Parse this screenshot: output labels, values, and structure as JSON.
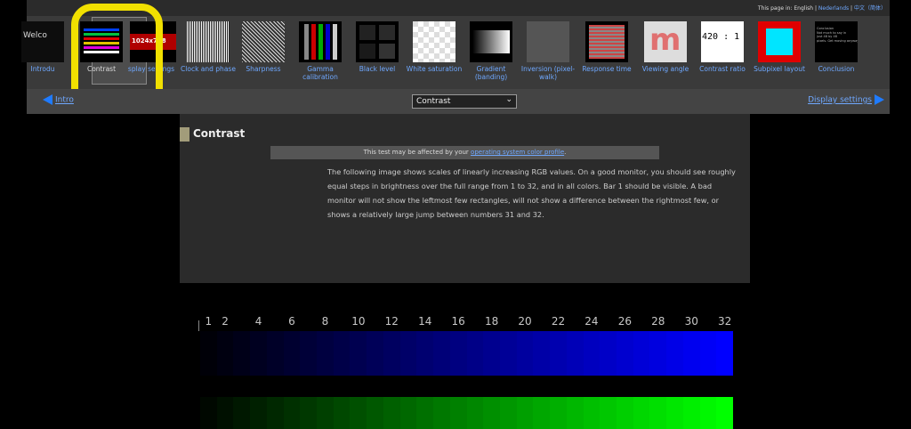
{
  "header": {
    "language_line": {
      "prefix": "This page in:",
      "current": "English",
      "sep1": " | ",
      "link1": "Nederlands",
      "sep2": " | ",
      "link2": "中文（简体）"
    }
  },
  "nav": {
    "items": [
      {
        "label": "Introduction",
        "thumb_text": "Welco"
      },
      {
        "label": "Contrast",
        "selected": true
      },
      {
        "label": "Display settings",
        "thumb_text": "1024x768"
      },
      {
        "label": "Clock and phase"
      },
      {
        "label": "Sharpness"
      },
      {
        "label": "Gamma calibration"
      },
      {
        "label": "Black level"
      },
      {
        "label": "White saturation"
      },
      {
        "label": "Gradient (banding)"
      },
      {
        "label": "Inversion (pixel-walk)"
      },
      {
        "label": "Response time"
      },
      {
        "label": "Viewing angle",
        "thumb_text": "m"
      },
      {
        "label": "Contrast ratio",
        "thumb_text": "420 : 1"
      },
      {
        "label": "Subpixel layout"
      },
      {
        "label": "Conclusion",
        "thumb_text": "Conclusion\nNot much to say in\njust 48 by 48\npixels. Get moving anyway."
      }
    ],
    "visible_labels": [
      "Introdu",
      "Contrast",
      "splay settings",
      "Clock and phase",
      "Sharpness",
      "Gamma calibration",
      "Black level",
      "White saturation",
      "Gradient (banding)",
      "Inversion (pixel-walk)",
      "Response time",
      "Viewing angle",
      "Contrast ratio",
      "Subpixel layout",
      "Conclusion"
    ]
  },
  "subnav": {
    "prev_label": "Intro",
    "next_label": "Display settings",
    "select_value": "Contrast"
  },
  "content": {
    "title": "Contrast",
    "notice_prefix": "This test may be affected by your ",
    "notice_link": "operating system color profile",
    "notice_suffix": ".",
    "description": "The following image shows scales of linearly increasing RGB values. On a good monitor, you should see roughly equal steps in brightness over the full range from 1 to 32, and in all colors. Bar 1 should be visible. A bad monitor will not show the leftmost few rectangles, will not show a difference between the rightmost few, or shows a relatively large jump between numbers 31 and 32."
  },
  "scale": {
    "labels": [
      "1",
      "2",
      "4",
      "6",
      "8",
      "10",
      "12",
      "14",
      "16",
      "18",
      "20",
      "22",
      "24",
      "26",
      "28",
      "30",
      "32"
    ],
    "steps": 32
  },
  "colors": {
    "highlight": "#f1e000",
    "link": "#6fa8ff",
    "arrow": "#1f7bff",
    "bar_blue": "#0000ff",
    "bar_green": "#00ff00"
  }
}
